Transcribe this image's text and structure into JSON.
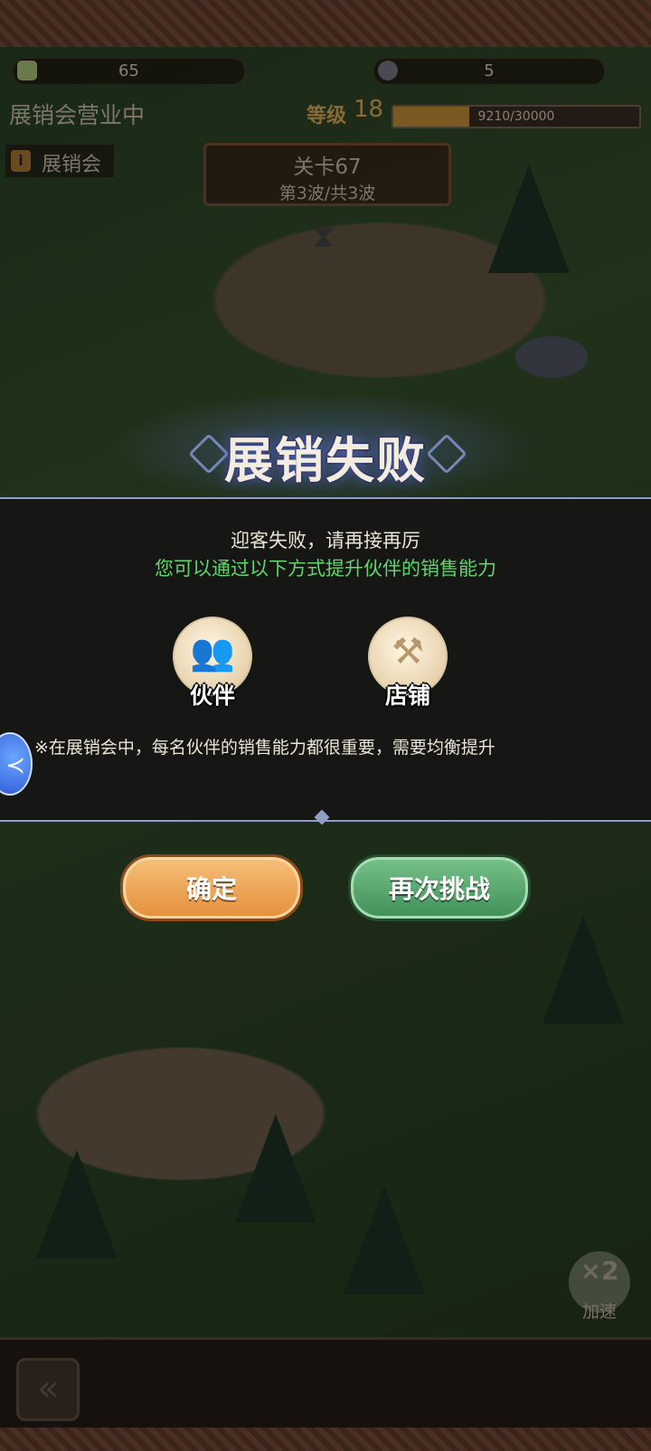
{
  "hud": {
    "resource_1_value": "65",
    "resource_2_value": "5",
    "status_text": "展销会营业中",
    "level_label": "等级",
    "level_value": "18",
    "xp_text": "9210/30000",
    "xp_fraction": 0.307,
    "fair_label": "展销会"
  },
  "stage": {
    "title": "关卡67",
    "wave": "第3波/共3波"
  },
  "modal": {
    "title": "展销失败",
    "message": "迎客失败，请再接再厉",
    "hint": "您可以通过以下方式提升伙伴的销售能力",
    "options": [
      {
        "label": "伙伴",
        "icon": "partners-icon"
      },
      {
        "label": "店铺",
        "icon": "shop-icon"
      }
    ],
    "note": "※在展销会中，每名伙伴的销售能力都很重要，需要均衡提升",
    "confirm_label": "确定",
    "retry_label": "再次挑战"
  },
  "speed": {
    "multiplier": "×2",
    "label": "加速"
  },
  "colors": {
    "confirm_button": "#e48f3a",
    "retry_button": "#3f8f58",
    "hint_text": "#5fd66a",
    "modal_border": "#8f9ec7"
  }
}
